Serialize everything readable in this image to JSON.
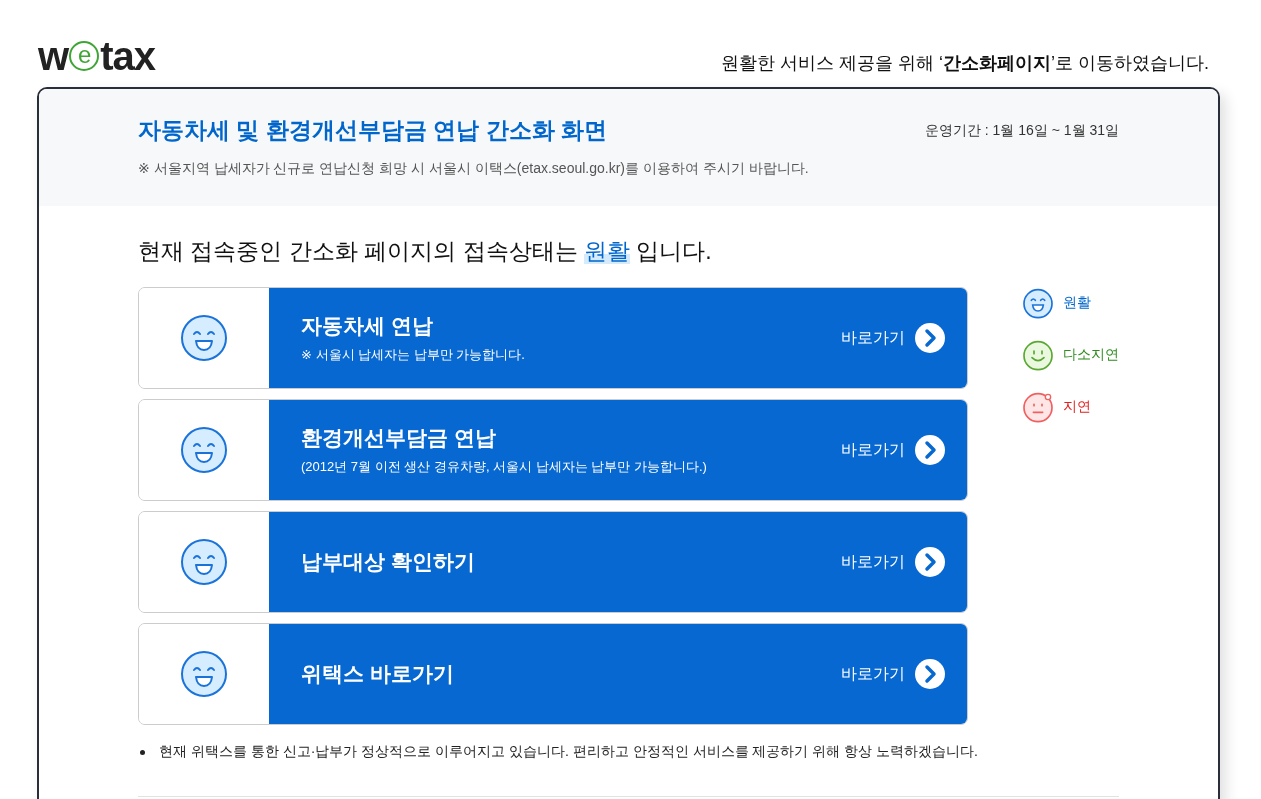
{
  "logo": {
    "before": "w",
    "circled": "e",
    "after": "tax"
  },
  "notice": "원활한 서비스 제공을 위해 ‘**간소화페이지**’로 이동하였습니다.",
  "header": {
    "title": "자동차세 및 환경개선부담금 연납 간소화 화면",
    "period": "운영기간 : 1월 16일 ~ 1월 31일",
    "note": "※ 서울지역 납세자가 신규로 연납신청 희망 시 서울시 이택스(etax.seoul.go.kr)를 이용하여 주시기 바랍니다."
  },
  "status_line": {
    "before": "현재 접속중인 간소화 페이지의 접속상태는",
    "status": "원활",
    "after": "입니다."
  },
  "services": [
    {
      "title": "자동차세 연납",
      "subtitle": "※ 서울시 납세자는 납부만 가능합니다.",
      "kind": "smooth",
      "link": "바로가기"
    },
    {
      "title": "환경개선부담금 연납",
      "subtitle": "(2012년 7월 이전 생산 경유차량, 서울시 납세자는 납부만 가능합니다.)",
      "kind": "smooth",
      "link": "바로가기"
    },
    {
      "title": "납부대상 확인하기",
      "kind": "smooth",
      "link": "바로가기"
    },
    {
      "title": "위택스 바로가기",
      "kind": "smooth",
      "link": "바로가기"
    }
  ],
  "legend": [
    {
      "kind": "smooth",
      "label": "원활",
      "color": "#0066cc"
    },
    {
      "kind": "slight",
      "label": "다소지연",
      "color": "#2e8b1e"
    },
    {
      "kind": "delay",
      "label": "지연",
      "color": "#e02020"
    }
  ],
  "bullets": [
    "현재 위택스를 통한 신고·납부가 정상적으로 이루어지고 있습니다. 편리하고 안정적인 서비스를 제공하기 위해 항상 노력하겠습니다."
  ]
}
